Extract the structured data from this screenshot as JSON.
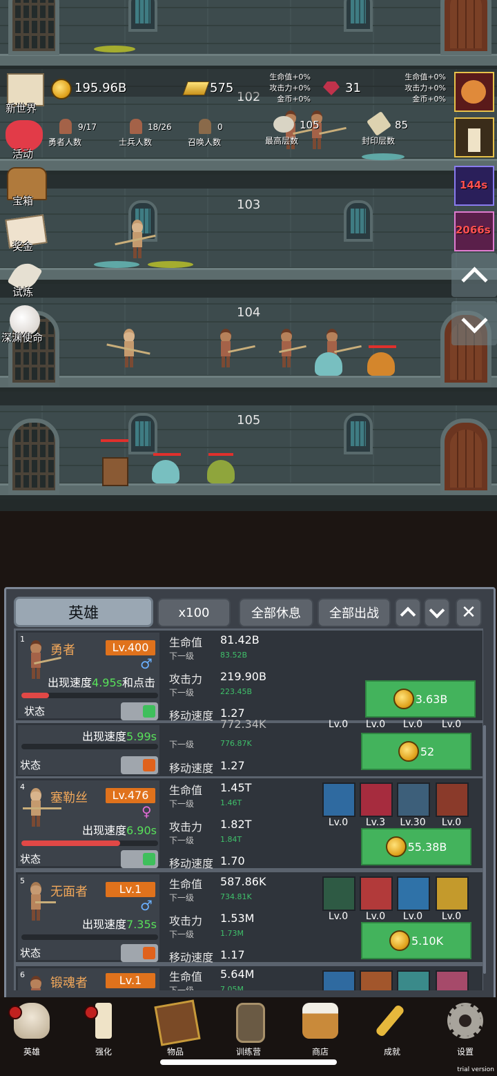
{
  "hud": {
    "gold": "195.96B",
    "gold_bar": "575",
    "gems": "31",
    "stat_lines_left": [
      "生命值+0%",
      "攻击力+0%",
      "金币+0%"
    ],
    "stat_lines_right": [
      "生命值+0%",
      "攻击力+0%",
      "金币+0%"
    ],
    "counts": [
      {
        "value": "9/17",
        "label": "勇者人数"
      },
      {
        "value": "18/26",
        "label": "士兵人数"
      },
      {
        "value": "0",
        "label": "召唤人数"
      },
      {
        "value": "105",
        "label": "最高层数"
      },
      {
        "value": "85",
        "label": "封印层数"
      }
    ]
  },
  "floors": [
    "102",
    "103",
    "104",
    "105"
  ],
  "left_menu": [
    "新世界",
    "活动",
    "宝箱",
    "奖金",
    "试炼",
    "深渊使命"
  ],
  "timers": [
    "144s",
    "2066s"
  ],
  "panel": {
    "title": "英雄",
    "multiplier": "x100",
    "rest_all": "全部休息",
    "deploy_all": "全部出战"
  },
  "heroes": [
    {
      "index": "1",
      "name": "勇者",
      "level": "Lv.400",
      "appear_label": "出现速度",
      "appear_value": "4.95s",
      "appear_suffix": "和点击",
      "state": "状态",
      "hp": "81.42B",
      "hp_next": "83.52B",
      "atk": "219.90B",
      "atk_next": "223.45B",
      "speed": "1.27",
      "cost": "3.63B",
      "hp_fill": 0.2
    },
    {
      "index": "",
      "name": "",
      "level": "",
      "appear_label": "出现速度",
      "appear_value": "5.99s",
      "appear_suffix": "",
      "state": "状态",
      "atk": "772.34K",
      "atk_next": "776.87K",
      "speed": "1.27",
      "cost": "52",
      "skill_levels": [
        "Lv.0",
        "Lv.0",
        "Lv.0",
        "Lv.0"
      ]
    },
    {
      "index": "4",
      "name": "塞勒丝",
      "level": "Lv.476",
      "appear_label": "出现速度",
      "appear_value": "6.90s",
      "appear_suffix": "",
      "state": "状态",
      "hp": "1.45T",
      "hp_next": "1.46T",
      "atk": "1.82T",
      "atk_next": "1.84T",
      "speed": "1.70",
      "cost": "55.38B",
      "hp_fill": 0.72,
      "skill_levels": [
        "Lv.0",
        "Lv.3",
        "Lv.30",
        "Lv.0"
      ]
    },
    {
      "index": "5",
      "name": "无面者",
      "level": "Lv.1",
      "appear_label": "出现速度",
      "appear_value": "7.35s",
      "appear_suffix": "",
      "state": "状态",
      "hp": "587.86K",
      "hp_next": "734.81K",
      "atk": "1.53M",
      "atk_next": "1.73M",
      "speed": "1.17",
      "cost": "5.10K",
      "skill_levels": [
        "Lv.0",
        "Lv.0",
        "Lv.0",
        "Lv.0"
      ]
    },
    {
      "index": "6",
      "name": "锻魂者",
      "level": "Lv.1",
      "hp": "5.64M",
      "hp_next": "7.05M"
    }
  ],
  "stat_labels": {
    "hp": "生命值",
    "atk": "攻击力",
    "next": "下一级",
    "speed": "移动速度"
  },
  "nav": [
    "英雄",
    "强化",
    "物品",
    "训练营",
    "商店",
    "成就",
    "设置"
  ],
  "trial": "trial version",
  "colors": {
    "upgrade_green": "#43b35c",
    "level_orange": "#e0721c",
    "name_orange": "#f2a85a",
    "hp_red": "#e14846"
  }
}
